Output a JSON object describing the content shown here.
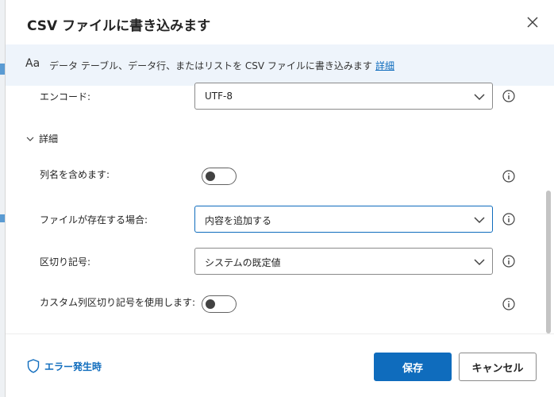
{
  "dialog": {
    "title": "CSV ファイルに書き込みます",
    "close_icon": "close-icon"
  },
  "banner": {
    "aa": "Aa",
    "description": "データ テーブル、データ行、またはリストを CSV ファイルに書き込みます",
    "link": "詳細"
  },
  "fields": {
    "encoding": {
      "label": "エンコード:",
      "value": "UTF-8"
    },
    "advanced_section": "詳細",
    "include_columns": {
      "label": "列名を含めます:",
      "on": false
    },
    "if_file_exists": {
      "label": "ファイルが存在する場合:",
      "value": "内容を追加する"
    },
    "separator": {
      "label": "区切り記号:",
      "value": "システムの既定値"
    },
    "custom_separator": {
      "label": "カスタム列区切り記号を使用します:",
      "on": false
    }
  },
  "footer": {
    "on_error": "エラー発生時",
    "save": "保存",
    "cancel": "キャンセル"
  },
  "colors": {
    "accent": "#0f6cbd",
    "banner_bg": "#eef4fb"
  }
}
